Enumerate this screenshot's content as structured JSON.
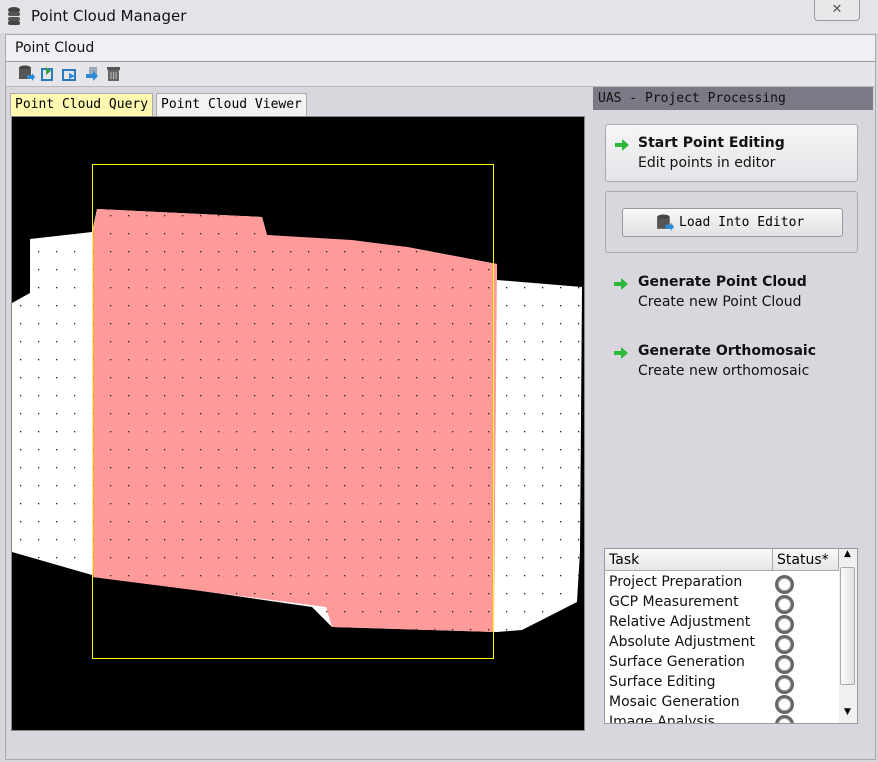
{
  "window": {
    "title": "Point Cloud Manager",
    "close_label": "✕"
  },
  "menu": {
    "title": "Point Cloud"
  },
  "toolbar": {
    "icons": [
      "load-database-icon",
      "import-icon",
      "export-icon",
      "transfer-icon",
      "trash-icon"
    ]
  },
  "tabs": [
    {
      "label": "Point Cloud Query",
      "active": true
    },
    {
      "label": "Point Cloud Viewer",
      "active": false
    }
  ],
  "viewer": {
    "colors": {
      "background": "#000000",
      "cloud": "#ffffff",
      "selection": "#ff9999",
      "bbox": "#ffff00"
    }
  },
  "panel": {
    "header": "UAS - Project Processing",
    "start_editing": {
      "title": "Start Point Editing",
      "subtitle": "Edit points in editor"
    },
    "load_button": "Load Into Editor",
    "generate_cloud": {
      "title": "Generate Point Cloud",
      "subtitle": "Create new Point Cloud"
    },
    "generate_ortho": {
      "title": "Generate Orthomosaic",
      "subtitle": "Create new orthomosaic"
    }
  },
  "tasks": {
    "columns": [
      "Task",
      "Status*"
    ],
    "rows": [
      "Project Preparation",
      "GCP Measurement",
      "Relative Adjustment",
      "Absolute Adjustment",
      "Surface Generation",
      "Surface Editing",
      "Mosaic Generation",
      "Image Analysis"
    ]
  }
}
